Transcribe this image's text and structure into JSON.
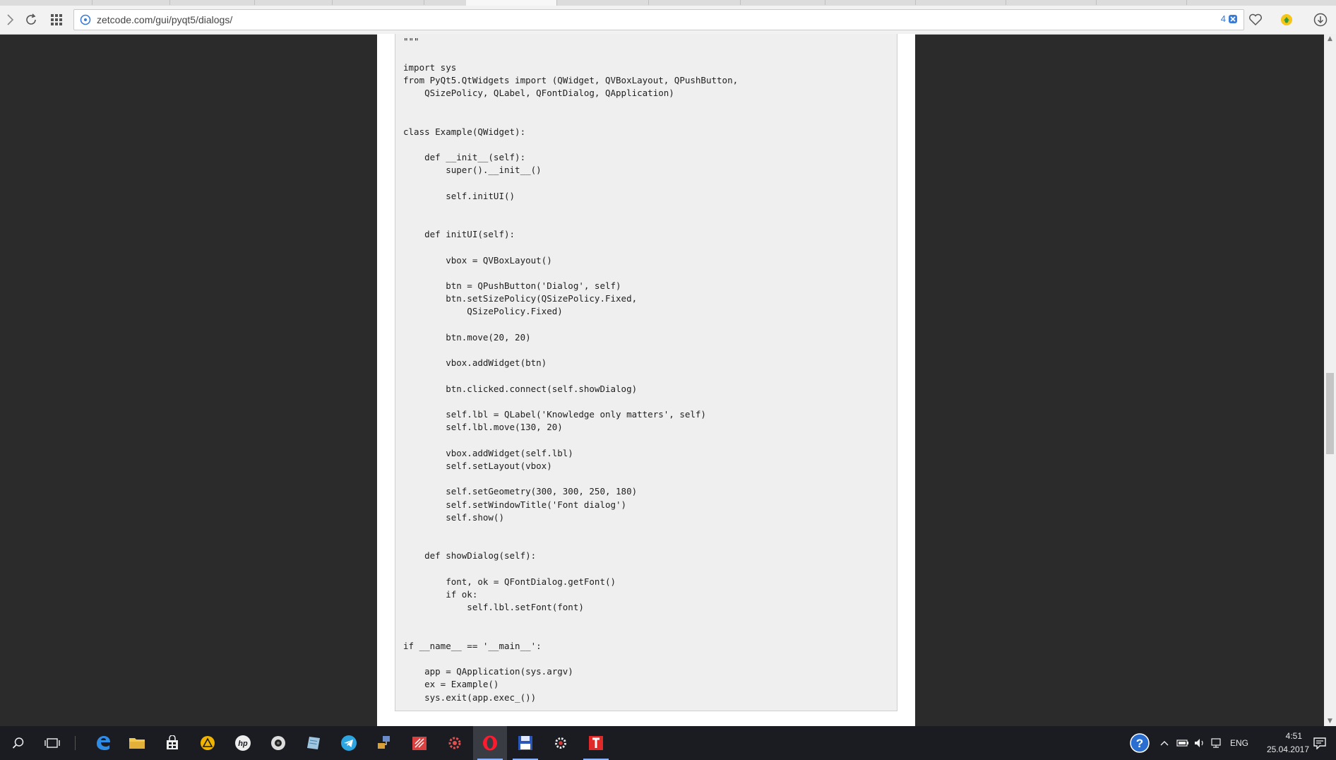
{
  "browser": {
    "url": "zetcode.com/gui/pyqt5/dialogs/",
    "notification_count": "4"
  },
  "code": {
    "lines": [
      "",
      "\"\"\"",
      "",
      "import sys",
      "from PyQt5.QtWidgets import (QWidget, QVBoxLayout, QPushButton,",
      "    QSizePolicy, QLabel, QFontDialog, QApplication)",
      "",
      "",
      "class Example(QWidget):",
      "",
      "    def __init__(self):",
      "        super().__init__()",
      "",
      "        self.initUI()",
      "",
      "",
      "    def initUI(self):",
      "",
      "        vbox = QVBoxLayout()",
      "",
      "        btn = QPushButton('Dialog', self)",
      "        btn.setSizePolicy(QSizePolicy.Fixed,",
      "            QSizePolicy.Fixed)",
      "",
      "        btn.move(20, 20)",
      "",
      "        vbox.addWidget(btn)",
      "",
      "        btn.clicked.connect(self.showDialog)",
      "",
      "        self.lbl = QLabel('Knowledge only matters', self)",
      "        self.lbl.move(130, 20)",
      "",
      "        vbox.addWidget(self.lbl)",
      "        self.setLayout(vbox)",
      "",
      "        self.setGeometry(300, 300, 250, 180)",
      "        self.setWindowTitle('Font dialog')",
      "        self.show()",
      "",
      "",
      "    def showDialog(self):",
      "",
      "        font, ok = QFontDialog.getFont()",
      "        if ok:",
      "            self.lbl.setFont(font)",
      "",
      "",
      "if __name__ == '__main__':",
      "",
      "    app = QApplication(sys.argv)",
      "    ex = Example()",
      "    sys.exit(app.exec_())"
    ]
  },
  "taskbar": {
    "language": "ENG",
    "time": "4:51",
    "date": "25.04.2017"
  },
  "colors": {
    "page_background": "#2b2b2b",
    "code_background": "#efefef",
    "taskbar": "#1a1c22",
    "accent": "#3a7bd5"
  }
}
